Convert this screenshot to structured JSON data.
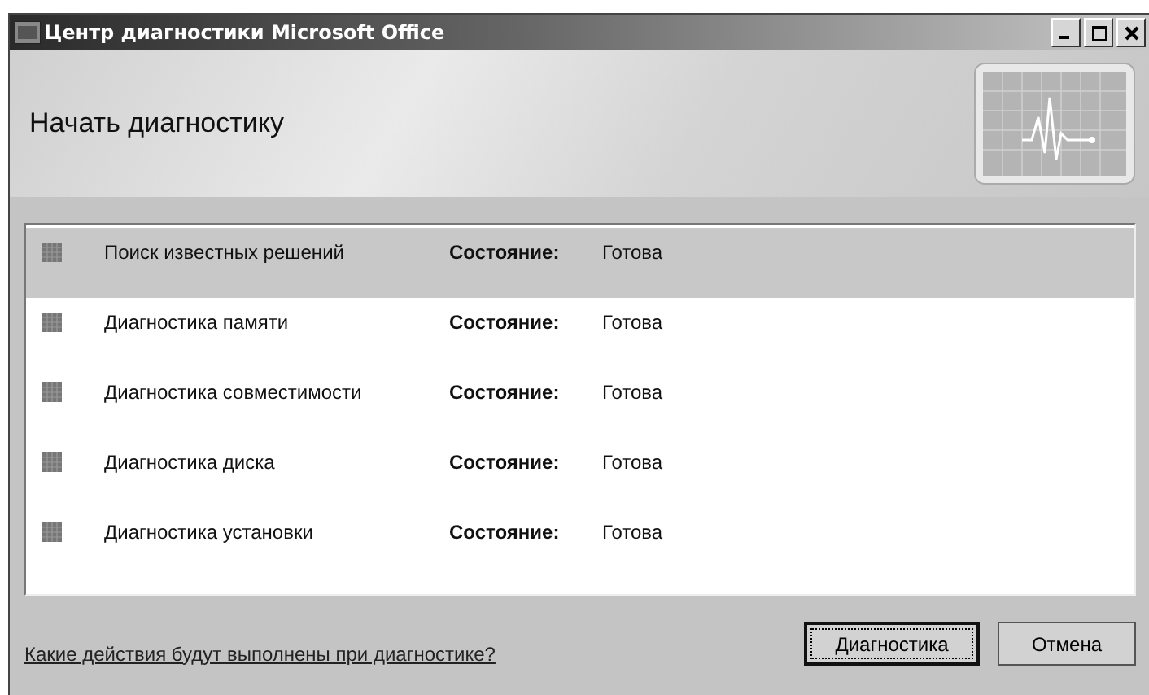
{
  "window": {
    "title": "Центр диагностики Microsoft Office"
  },
  "header": {
    "title": "Начать диагностику"
  },
  "tasks": [
    {
      "name": "Поиск известных решений",
      "status_label": "Состояние:",
      "status": "Готова",
      "selected": true
    },
    {
      "name": "Диагностика памяти",
      "status_label": "Состояние:",
      "status": "Готова",
      "selected": false
    },
    {
      "name": "Диагностика совместимости",
      "status_label": "Состояние:",
      "status": "Готова",
      "selected": false
    },
    {
      "name": "Диагностика диска",
      "status_label": "Состояние:",
      "status": "Готова",
      "selected": false
    },
    {
      "name": "Диагностика установки",
      "status_label": "Состояние:",
      "status": "Готова",
      "selected": false
    }
  ],
  "help_link": "Какие действия будут выполнены при диагностике?",
  "buttons": [
    {
      "label": "Диагностика",
      "default": true
    },
    {
      "label": "Отмена",
      "default": false
    }
  ]
}
